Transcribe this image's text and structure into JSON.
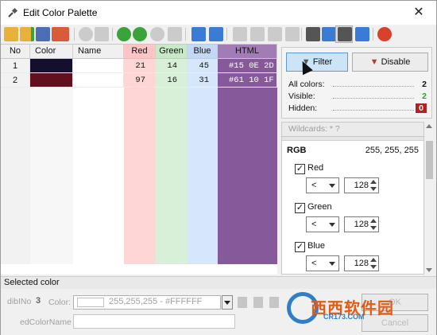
{
  "window": {
    "title": "Edit Color Palette",
    "close_glyph": "✕"
  },
  "toolbar": {
    "icons": [
      "open-folder-icon",
      "add-folder-icon",
      "edit-icon",
      "import-icon",
      "settings-icon",
      "palette-icon",
      "add-green-icon",
      "add-circle-icon",
      "remove-circle-icon",
      "text-clear-icon",
      "grid-icon",
      "grid-small-icon",
      "move-top-icon",
      "move-up-icon",
      "move-down-icon",
      "move-bottom-icon",
      "number-icon",
      "sort-icon",
      "filter-icon",
      "columns-icon",
      "refresh-icon"
    ]
  },
  "grid": {
    "columns": [
      "No",
      "Color",
      "Name",
      "Red",
      "Green",
      "Blue",
      "HTML"
    ],
    "rows": [
      {
        "no": "1",
        "color": "#150e2d",
        "name": "",
        "red": "21",
        "green": "14",
        "blue": "45",
        "html": "#15 0E 2D"
      },
      {
        "no": "2",
        "color": "#61101f",
        "name": "",
        "red": "97",
        "green": "16",
        "blue": "31",
        "html": "#61 10 1F"
      }
    ],
    "column_colors": {
      "red": "#ffd6d6",
      "green": "#d8f0d8",
      "blue": "#d6e6fb",
      "html": "#85599a"
    }
  },
  "filter": {
    "filter_button": "Filter",
    "disable_button": "Disable",
    "all_label": "All colors:",
    "all_value": "2",
    "visible_label": "Visible:",
    "visible_value": "2",
    "hidden_label": "Hidden:",
    "hidden_value": "0",
    "wildcards": "Wildcards: * ?",
    "rgb_title": "RGB",
    "rgb_value": "255, 255, 255",
    "channels": [
      {
        "label": "Red",
        "op": "<",
        "value": "128",
        "checked": "✓"
      },
      {
        "label": "Green",
        "op": "<",
        "value": "128",
        "checked": "✓"
      },
      {
        "label": "Blue",
        "op": "<",
        "value": "128",
        "checked": "✓"
      }
    ]
  },
  "selected": {
    "section_label": "Selected color",
    "dib_label": "dibINo",
    "dib_value": "3",
    "color_label": "Color:",
    "color_value": "255,255,255 - #FFFFFF",
    "name_label": "edColorName",
    "name_value": "",
    "ok_label": "OK",
    "cancel_label": "Cancel"
  },
  "watermark": {
    "text": "西西软件园",
    "sub": "CR173.COM"
  }
}
